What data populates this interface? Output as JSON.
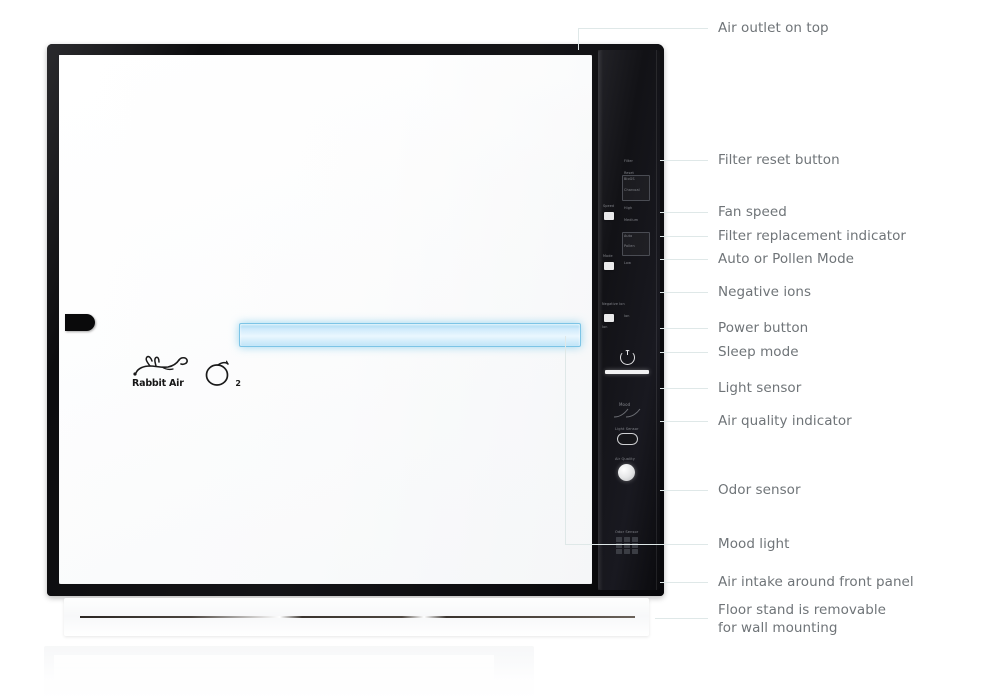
{
  "diagram": {
    "subject": "Rabbit Air air purifier front view with feature callouts",
    "brand": {
      "name": "Rabbit Air",
      "logo_icon": "rabbit-icon",
      "secondary_mark": "O",
      "secondary_mark_subscript": "2"
    },
    "colors": {
      "label_text": "#6f7478",
      "leader_line": "#dfe8e8",
      "body": "#111113",
      "panel": "#ffffff",
      "mood_light": "#bfe4f8",
      "mood_light_edge": "#7cc4e6"
    }
  },
  "callouts": [
    {
      "id": "air-outlet",
      "label": "Air outlet on top"
    },
    {
      "id": "filter-reset",
      "label": "Filter reset button"
    },
    {
      "id": "fan-speed",
      "label": "Fan speed"
    },
    {
      "id": "filter-replacement",
      "label": "Filter replacement indicator"
    },
    {
      "id": "auto-pollen",
      "label": "Auto or Pollen Mode"
    },
    {
      "id": "negative-ions",
      "label": "Negative ions"
    },
    {
      "id": "power-button",
      "label": "Power button"
    },
    {
      "id": "sleep-mode",
      "label": "Sleep mode"
    },
    {
      "id": "light-sensor",
      "label": "Light sensor"
    },
    {
      "id": "air-quality",
      "label": "Air quality indicator"
    },
    {
      "id": "odor-sensor",
      "label": "Odor sensor"
    },
    {
      "id": "mood-light",
      "label": "Mood light"
    },
    {
      "id": "air-intake",
      "label": "Air intake around front panel"
    },
    {
      "id": "floor-stand",
      "label": "Floor stand is removable\nfor wall mounting"
    }
  ],
  "control_panel": {
    "indicators": [
      {
        "id": "ind-1",
        "text": "Filter"
      },
      {
        "id": "ind-2",
        "text": "Reset"
      },
      {
        "id": "ind-3",
        "text": "BioGS"
      },
      {
        "id": "ind-4",
        "text": "Charcoal"
      },
      {
        "id": "ind-5",
        "text": "Speed"
      },
      {
        "id": "ind-6",
        "text": "High"
      },
      {
        "id": "ind-7",
        "text": "Medium"
      },
      {
        "id": "ind-8",
        "text": "Low"
      },
      {
        "id": "ind-9",
        "text": "Mode"
      },
      {
        "id": "ind-10",
        "text": "Auto"
      },
      {
        "id": "ind-11",
        "text": "Pollen"
      },
      {
        "id": "ind-12",
        "text": "Ion"
      },
      {
        "id": "ind-13",
        "text": "Negative Ion"
      },
      {
        "id": "ind-14",
        "text": "Mood"
      },
      {
        "id": "ind-15",
        "text": "Light Sensor"
      },
      {
        "id": "ind-16",
        "text": "Air Quality"
      },
      {
        "id": "ind-17",
        "text": "Odor Sensor"
      }
    ]
  }
}
